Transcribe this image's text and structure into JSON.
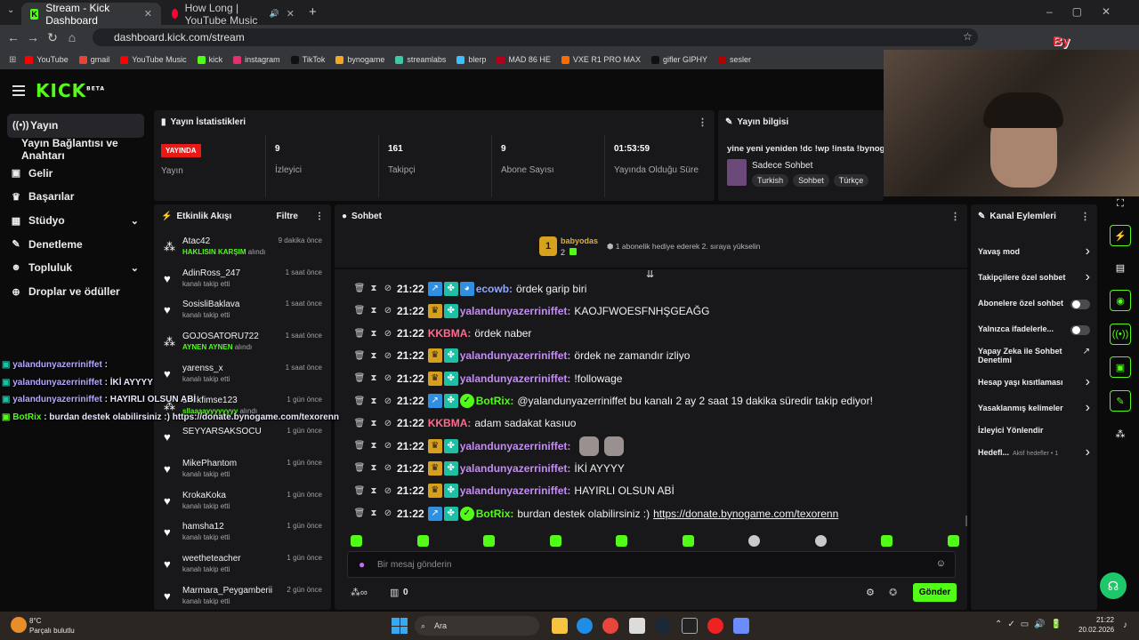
{
  "browser": {
    "tabs": [
      {
        "title": "Stream - Kick Dashboard"
      },
      {
        "title": "How Long | YouTube Music"
      }
    ],
    "url": "dashboard.kick.com/stream",
    "bookmarks": [
      "YouTube",
      "gmail",
      "YouTube Music",
      "kick",
      "instagram",
      "TikTok",
      "bynogame",
      "streamlabs",
      "blerp",
      "MAD 86 HE",
      "VXE R1 PRO MAX",
      "gifler GIPHY",
      "sesler"
    ],
    "bookmark_colors": [
      "#ff0000",
      "#ea4335",
      "#ff0000",
      "#53fc18",
      "#e1306c",
      "#111111",
      "#f5a623",
      "#41c7a4",
      "#3ac1ff",
      "#b3001b",
      "#ff6a00",
      "#111111",
      "#b30000"
    ]
  },
  "sidebar": {
    "items": [
      {
        "label": "Yayın",
        "icon": "broadcast-icon"
      },
      {
        "label": "Yayın Bağlantısı ve Anahtarı"
      },
      {
        "label": "Gelir",
        "icon": "wallet-icon"
      },
      {
        "label": "Başarılar",
        "icon": "trophy-icon"
      },
      {
        "label": "Stüdyo",
        "icon": "studio-icon"
      },
      {
        "label": "Denetleme",
        "icon": "wrench-icon"
      },
      {
        "label": "Topluluk",
        "icon": "people-icon"
      },
      {
        "label": "Droplar ve ödüller",
        "icon": "gift-icon"
      }
    ]
  },
  "stats": {
    "title": "Yayın İstatistikleri",
    "live_badge": "YAYINDA",
    "live_label": "Yayın",
    "viewers": {
      "value": "9",
      "label": "İzleyici"
    },
    "followers": {
      "value": "161",
      "label": "Takipçi"
    },
    "subs": {
      "value": "9",
      "label": "Abone Sayısı"
    },
    "uptime": {
      "value": "01:53:59",
      "label": "Yayında Olduğu Süre"
    }
  },
  "info": {
    "title": "Yayın bilgisi",
    "stream_title": "yine yeni yeniden !dc !wp !insta !bynog",
    "category": "Sadece Sohbet",
    "tags": [
      "Turkish",
      "Sohbet",
      "Türkçe"
    ]
  },
  "activity": {
    "title": "Etkinlik Akışı",
    "filter": "Filtre",
    "items": [
      {
        "name": "Atac42",
        "sub_em": "HAKLISIN KARŞIM",
        "sub": "alındı",
        "time": "9 dakika önce",
        "icon": "redeem-icon"
      },
      {
        "name": "AdinRoss_247",
        "sub": "kanalı takip etti",
        "time": "1 saat önce",
        "icon": "heart-icon"
      },
      {
        "name": "SosisliBaklava",
        "sub": "kanalı takip etti",
        "time": "1 saat önce",
        "icon": "heart-icon"
      },
      {
        "name": "GOJOSATORU722",
        "sub_em": "AYNEN AYNEN",
        "sub": "alındı",
        "time": "1 saat önce",
        "icon": "redeem-icon"
      },
      {
        "name": "yarenss_x",
        "sub": "kanalı takip etti",
        "time": "1 saat önce",
        "icon": "heart-icon"
      },
      {
        "name": "Luckfimse123",
        "sub_em": "sllaaaayyyyyyyy",
        "sub": "alındı",
        "time": "1 gün önce",
        "icon": "redeem-icon"
      },
      {
        "name": "SEYYARSAKSOCU",
        "sub": "",
        "time": "1 gün önce",
        "icon": "heart-icon"
      },
      {
        "name": "MikePhantom",
        "sub": "kanalı takip etti",
        "time": "1 gün önce",
        "icon": "heart-icon"
      },
      {
        "name": "KrokaKoka",
        "sub": "kanalı takip etti",
        "time": "1 gün önce",
        "icon": "heart-icon"
      },
      {
        "name": "hamsha12",
        "sub": "kanalı takip etti",
        "time": "1 gün önce",
        "icon": "heart-icon"
      },
      {
        "name": "weetheteacher",
        "sub": "kanalı takip etti",
        "time": "1 gün önce",
        "icon": "heart-icon"
      },
      {
        "name": "Marmara_Peygamberii",
        "sub": "kanalı takip etti",
        "time": "2 gün önce",
        "icon": "heart-icon"
      }
    ]
  },
  "chat": {
    "title": "Sohbet",
    "pinned": {
      "user": "babyodas",
      "count": "2",
      "text": "1 abonelik hediye ederek 2. sıraya yükselin",
      "rank": "1"
    },
    "messages": [
      {
        "time": "21:22",
        "badges": [
          "sub",
          "gift",
          "avatar"
        ],
        "user": "ecowb",
        "color": "blue",
        "text": "ördek garip biri"
      },
      {
        "time": "21:22",
        "badges": [
          "crown",
          "gift"
        ],
        "user": "yalandunyazerriniffet",
        "color": "purple",
        "text": "KAOJFWOESFNHŞGEAĞG"
      },
      {
        "time": "21:22",
        "badges": [],
        "user": "KKBMA",
        "color": "red",
        "text": "ördek naber"
      },
      {
        "time": "21:22",
        "badges": [
          "crown",
          "gift"
        ],
        "user": "yalandunyazerriniffet",
        "color": "purple",
        "text": "ördek ne zamandır izliyo"
      },
      {
        "time": "21:22",
        "badges": [
          "crown",
          "gift"
        ],
        "user": "yalandunyazerriniffet",
        "color": "purple",
        "text": "!followage"
      },
      {
        "time": "21:22",
        "badges": [
          "sub",
          "gift",
          "ver"
        ],
        "user": "BotRix",
        "color": "green",
        "text": "@yalandunyazerriniffet bu kanalı 2 ay 2 saat 19 dakika süredir takip ediyor!"
      },
      {
        "time": "21:22",
        "badges": [],
        "user": "KKBMA",
        "color": "red",
        "text": "adam sadakat kasıuo"
      },
      {
        "time": "21:22",
        "badges": [
          "crown",
          "gift"
        ],
        "user": "yalandunyazerriniffet",
        "color": "purple",
        "text": "",
        "emotes": 2
      },
      {
        "time": "21:22",
        "badges": [
          "crown",
          "gift"
        ],
        "user": "yalandunyazerriniffet",
        "color": "purple",
        "text": "İKİ AYYYY"
      },
      {
        "time": "21:22",
        "badges": [
          "crown",
          "gift"
        ],
        "user": "yalandunyazerriniffet",
        "color": "purple",
        "text": "HAYIRLI OLSUN ABİ"
      },
      {
        "time": "21:22",
        "badges": [
          "sub",
          "gift",
          "ver"
        ],
        "user": "BotRix",
        "color": "green",
        "text": "burdan destek olabilirsiniz :) ",
        "link": "https://donate.bynogame.com/texorenn"
      }
    ],
    "input_placeholder": "Bir mesaj gönderin",
    "points": "0",
    "send": "Gönder"
  },
  "actions": {
    "title": "Kanal Eylemleri",
    "items": [
      {
        "label": "Yavaş mod",
        "type": "arrow"
      },
      {
        "label": "Takipçilere özel sohbet",
        "type": "arrow"
      },
      {
        "label": "Abonelere özel sohbet",
        "type": "toggle"
      },
      {
        "label": "Yalnızca ifadelerle...",
        "type": "toggle"
      },
      {
        "label": "Yapay Zeka ile Sohbet Denetimi",
        "type": "external"
      },
      {
        "label": "Hesap yaşı kısıtlaması",
        "type": "arrow"
      },
      {
        "label": "Yasaklanmış kelimeler",
        "type": "arrow"
      },
      {
        "label": "İzleyici Yönlendir",
        "type": "none"
      },
      {
        "label": "Hedefl...",
        "extra": "Aktif hedefler • 1",
        "type": "arrow"
      }
    ]
  },
  "overlay": [
    {
      "user": "yalandunyazerriniffet",
      "text": ":"
    },
    {
      "user": "yalandunyazerriniffet",
      "text": ": İKİ AYYYY"
    },
    {
      "user": "yalandunyazerriniffet",
      "text": ": HAYIRLI OLSUN ABİ"
    },
    {
      "user": "BotRix",
      "text": ": burdan destek olabilirsiniz :) https://donate.bynogame.com/texorenn"
    }
  ],
  "taskbar": {
    "weather_temp": "8°C",
    "weather_text": "Parçalı bulutlu",
    "search": "Ara",
    "time": "21:22",
    "date": "20.02.2026"
  }
}
